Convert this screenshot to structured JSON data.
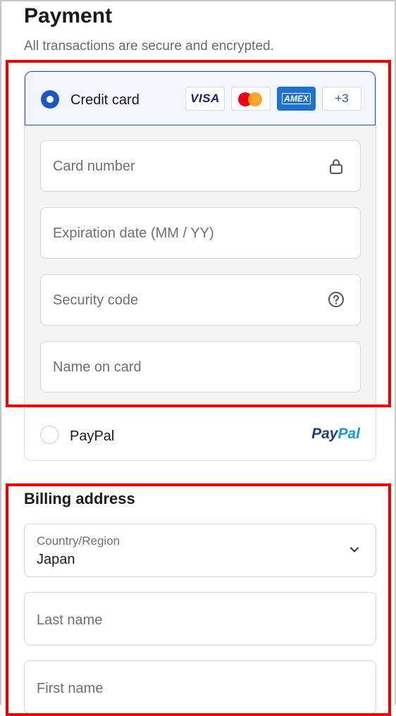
{
  "payment": {
    "title": "Payment",
    "subtitle": "All transactions are secure and encrypted.",
    "credit_card": {
      "label": "Credit card",
      "selected": true,
      "brands": {
        "visa": "VISA",
        "mastercard_icon": "mastercard-logo",
        "amex": "AMEX",
        "more": "+3"
      },
      "fields": {
        "card_number": "Card number",
        "expiration": "Expiration date (MM / YY)",
        "security_code": "Security code",
        "name_on_card": "Name on card"
      },
      "icons": {
        "card_number": "lock-icon",
        "security_code": "question-circle-icon"
      }
    },
    "paypal": {
      "label": "PayPal",
      "selected": false,
      "logo_part1": "Pay",
      "logo_part2": "Pal"
    }
  },
  "billing": {
    "title": "Billing address",
    "country_label": "Country/Region",
    "country_value": "Japan",
    "last_name": "Last name",
    "first_name": "First name"
  },
  "colors": {
    "accent": "#1c57c6",
    "highlight": "#f00000",
    "visa": "#1a1f71",
    "amex": "#1f72cd"
  }
}
